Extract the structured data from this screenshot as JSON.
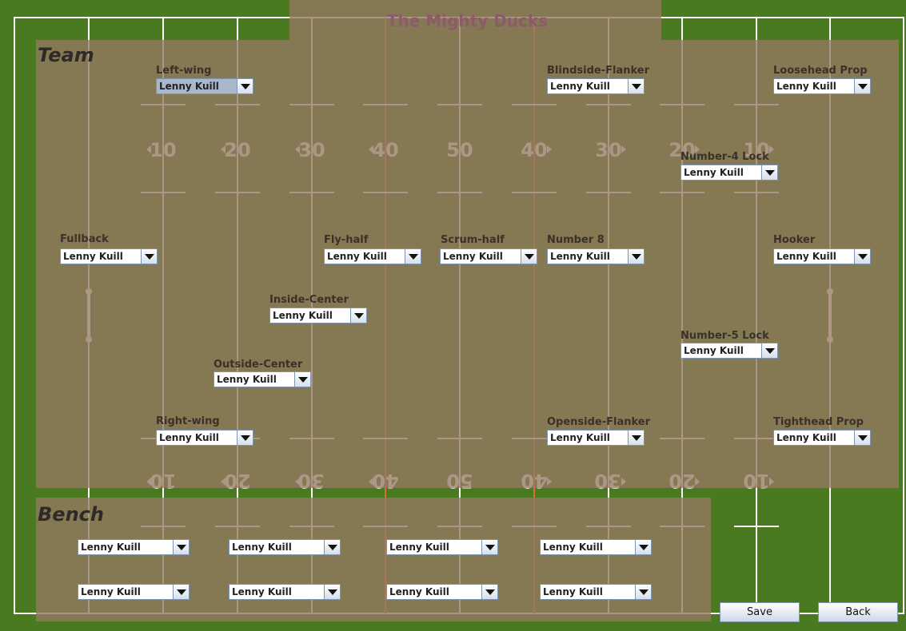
{
  "app_title": "The Mighty Ducks",
  "team_heading": "Team",
  "bench_heading": "Bench",
  "field": {
    "top_numbers": [
      "10",
      "20",
      "30",
      "40",
      "50",
      "40",
      "30",
      "20",
      "10"
    ],
    "bottom_numbers": [
      "10",
      "20",
      "30",
      "40",
      "50",
      "40",
      "30",
      "20",
      "10"
    ]
  },
  "positions": [
    {
      "key": "left-wing",
      "label": "Left-wing",
      "value": "Lenny Kuill",
      "selected": true
    },
    {
      "key": "blindside-flanker",
      "label": "Blindside-Flanker",
      "value": "Lenny Kuill"
    },
    {
      "key": "loosehead-prop",
      "label": "Loosehead Prop",
      "value": "Lenny Kuill"
    },
    {
      "key": "number-4-lock",
      "label": "Number-4 Lock",
      "value": "Lenny Kuill"
    },
    {
      "key": "fullback",
      "label": "Fullback",
      "value": "Lenny Kuill"
    },
    {
      "key": "fly-half",
      "label": "Fly-half",
      "value": "Lenny Kuill"
    },
    {
      "key": "scrum-half",
      "label": "Scrum-half",
      "value": "Lenny Kuill"
    },
    {
      "key": "number-8",
      "label": "Number 8",
      "value": "Lenny Kuill"
    },
    {
      "key": "hooker",
      "label": "Hooker",
      "value": "Lenny Kuill"
    },
    {
      "key": "inside-center",
      "label": "Inside-Center",
      "value": "Lenny Kuill"
    },
    {
      "key": "number-5-lock",
      "label": "Number-5 Lock",
      "value": "Lenny Kuill"
    },
    {
      "key": "outside-center",
      "label": "Outside-Center",
      "value": "Lenny Kuill"
    },
    {
      "key": "right-wing",
      "label": "Right-wing",
      "value": "Lenny Kuill"
    },
    {
      "key": "openside-flanker",
      "label": "Openside-Flanker",
      "value": "Lenny Kuill"
    },
    {
      "key": "tighthead-prop",
      "label": "Tighthead Prop",
      "value": "Lenny Kuill"
    }
  ],
  "bench": [
    "Lenny Kuill",
    "Lenny Kuill",
    "Lenny Kuill",
    "Lenny Kuill",
    "Lenny Kuill",
    "Lenny Kuill",
    "Lenny Kuill",
    "Lenny Kuill"
  ],
  "buttons": {
    "save": "Save",
    "back": "Back"
  },
  "colors": {
    "grass": "#4a7a1f",
    "line_white": "#ffffff",
    "line_pink": "#e8b4b4",
    "line_orange": "#e06a3a"
  }
}
